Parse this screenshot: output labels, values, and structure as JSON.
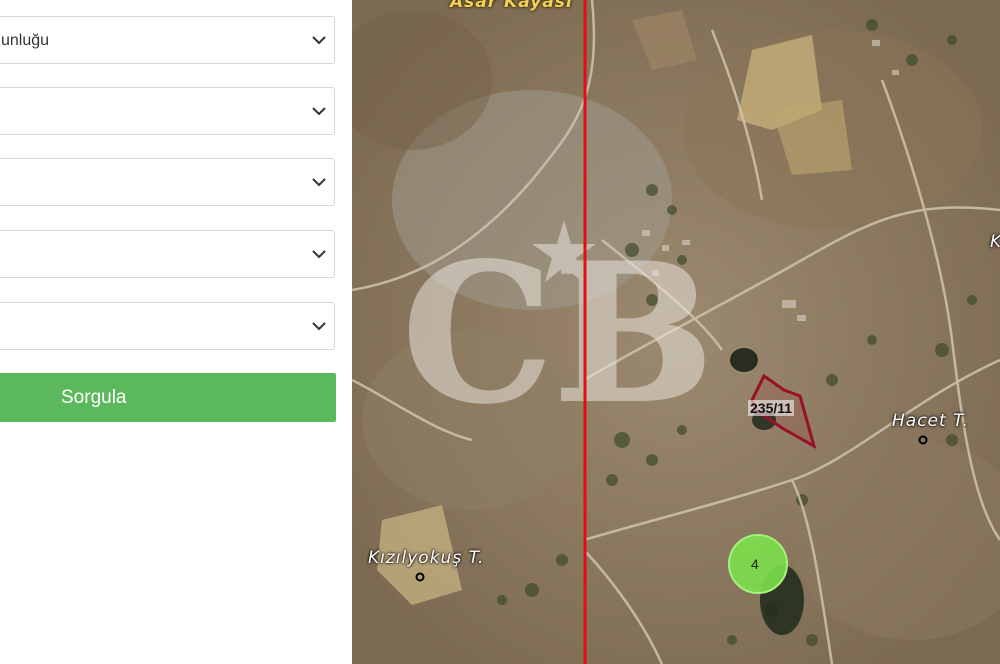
{
  "form": {
    "selects": [
      {
        "value": "unluğu"
      },
      {
        "value": ""
      },
      {
        "value": ""
      },
      {
        "value": ""
      },
      {
        "value": ""
      }
    ],
    "query_button": "Sorgula"
  },
  "map": {
    "place_labels": {
      "top": "Asar Kayası",
      "right_edge": "K",
      "hacet": "Hacet T.",
      "kizilyokus": "Kızılyokuş T."
    },
    "parcel_label": "235/11",
    "cluster_count": "4",
    "colors": {
      "boundary_line": "#e01010",
      "parcel_outline": "#9a0f2a",
      "cluster": "#7be04a",
      "button": "#5cb85c"
    },
    "watermark": "CB"
  }
}
